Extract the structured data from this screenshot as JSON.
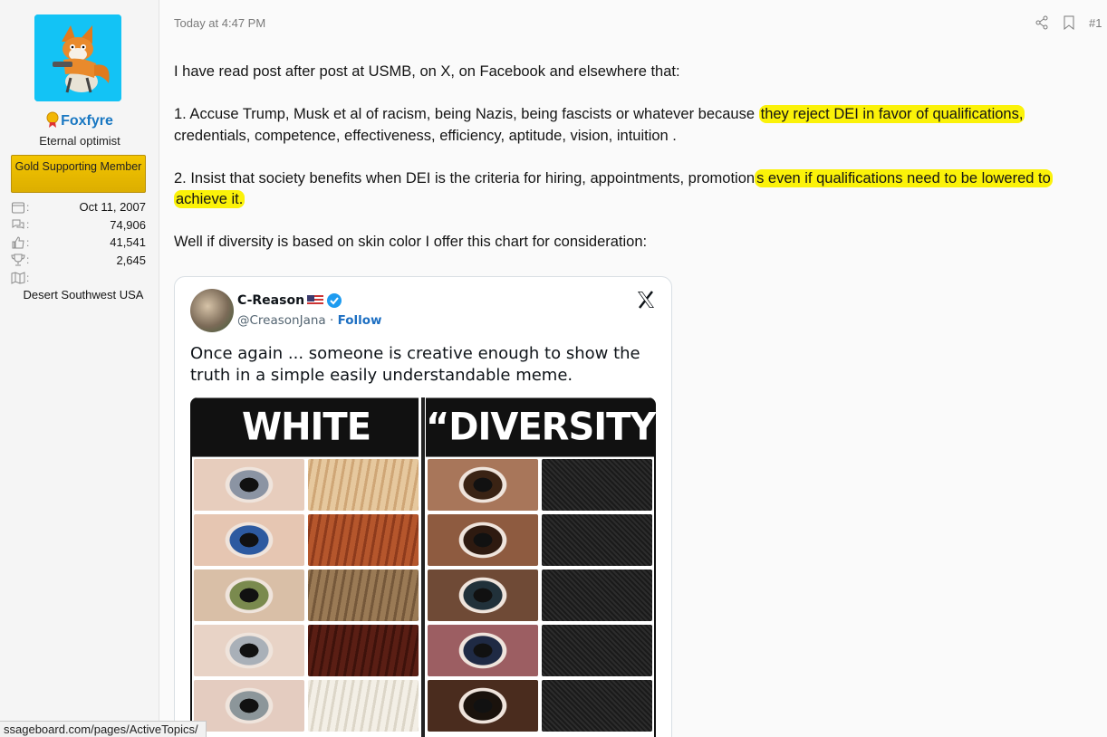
{
  "user": {
    "name": "Foxfyre",
    "title": "Eternal optimist",
    "banner": "Gold Supporting Member",
    "stats": [
      {
        "icon": "calendar-icon",
        "value": "Oct 11, 2007"
      },
      {
        "icon": "messages-icon",
        "value": "74,906"
      },
      {
        "icon": "thumbs-up-icon",
        "value": "41,541"
      },
      {
        "icon": "trophy-icon",
        "value": "2,645"
      },
      {
        "icon": "map-icon",
        "value": ""
      }
    ],
    "location": "Desert Southwest USA"
  },
  "post": {
    "date": "Today at 4:47 PM",
    "number": "#1",
    "p1": "I have read post after post at USMB, on X, on Facebook and elsewhere that:",
    "p2a": "1. Accuse Trump, Musk et al of racism, being Nazis, being fascists or whatever because ",
    "p2hl": "they reject DEI in favor of qualifications,",
    "p2b": "credentials, competence, effectiveness, efficiency, aptitude, vision, intuition .",
    "p3a": "2. Insist that society benefits when DEI is the criteria for hiring, appointments, promotion",
    "p3hl": "s even if qualifications need to be lowered to",
    "p3hl2": "achieve it.",
    "p4": "Well if diversity is based on skin color I offer this chart for consideration:"
  },
  "tweet": {
    "name": "C-Reason",
    "handle": "@CreasonJana",
    "separator": " · ",
    "follow": "Follow",
    "text": "Once again ... someone is creative enough to show the truth in a simple easily understandable meme.",
    "meme_left_title": "WHITE",
    "meme_right_title": "“DIVERSITY”"
  },
  "status_url": "ssageboard.com/pages/ActiveTopics/",
  "colors": {
    "highlight": "#fbf209",
    "username": "#1a78c2",
    "banner": "#f3c500",
    "avatar_bg": "#13c3f5",
    "follow": "#1d6fc2"
  }
}
